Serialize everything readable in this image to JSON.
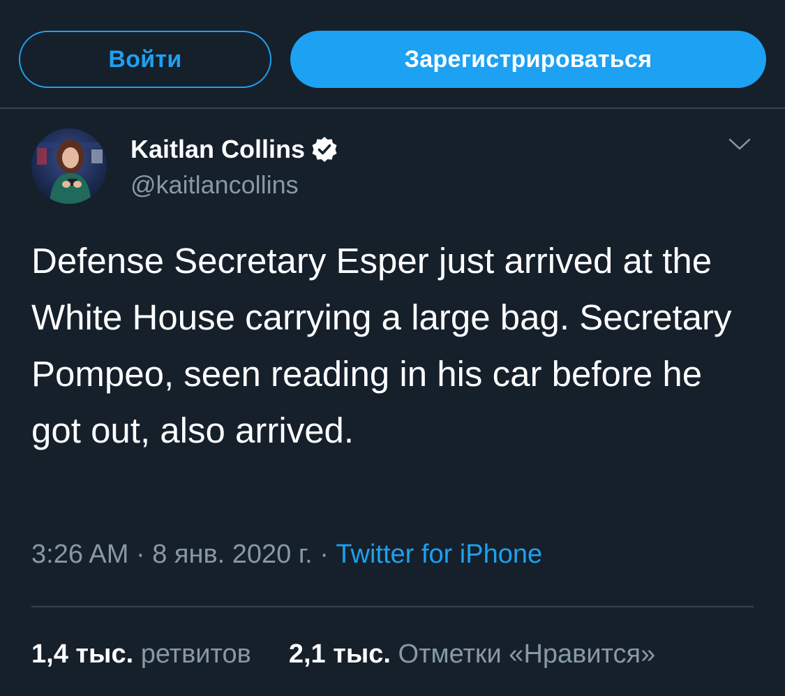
{
  "top_bar": {
    "login_label": "Войти",
    "signup_label": "Зарегистрироваться"
  },
  "tweet": {
    "author": {
      "display_name": "Kaitlan Collins",
      "handle": "@kaitlancollins",
      "verified": true
    },
    "text": "Defense Secretary Esper just arrived at the White House carrying a large bag. Secretary Pompeo, seen reading in his car before he got out, also arrived.",
    "meta": {
      "time": "3:26 AM",
      "separator_1": " · ",
      "date": "8 янв. 2020 г.",
      "separator_2": " · ",
      "source": "Twitter for iPhone"
    },
    "stats": {
      "retweets_count": "1,4 тыс.",
      "retweets_label": "ретвитов",
      "likes_count": "2,1 тыс.",
      "likes_label": "Отметки «Нравится»"
    }
  },
  "colors": {
    "background": "#15202b",
    "accent": "#1da1f2",
    "secondary_text": "#8899a6",
    "divider": "#38444d"
  },
  "icons": {
    "verified": "verified-badge-icon",
    "menu": "chevron-down-icon"
  }
}
